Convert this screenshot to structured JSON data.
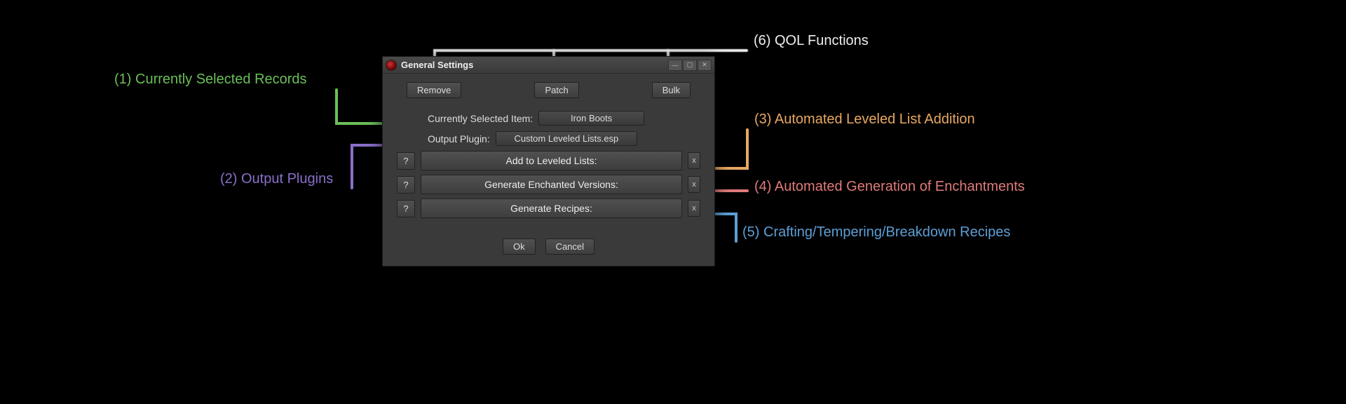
{
  "dialog": {
    "title": "General Settings",
    "top_buttons": {
      "remove": "Remove",
      "patch": "Patch",
      "bulk": "Bulk"
    },
    "selected_item": {
      "label": "Currently Selected Item:",
      "value": "Iron Boots"
    },
    "output_plugin": {
      "label": "Output Plugin:",
      "value": "Custom Leveled Lists.esp"
    },
    "actions": {
      "help": "?",
      "close_x": "x",
      "leveled": "Add to Leveled Lists:",
      "enchanted": "Generate Enchanted Versions:",
      "recipes": "Generate Recipes:"
    },
    "bottom": {
      "ok": "Ok",
      "cancel": "Cancel"
    }
  },
  "annotations": {
    "a1": "(1) Currently Selected Records",
    "a2": "(2) Output Plugins",
    "a3": "(3) Automated Leveled List Addition",
    "a4": "(4) Automated Generation of Enchantments",
    "a5": "(5) Crafting/Tempering/Breakdown Recipes",
    "a6": "(6) QOL Functions"
  }
}
